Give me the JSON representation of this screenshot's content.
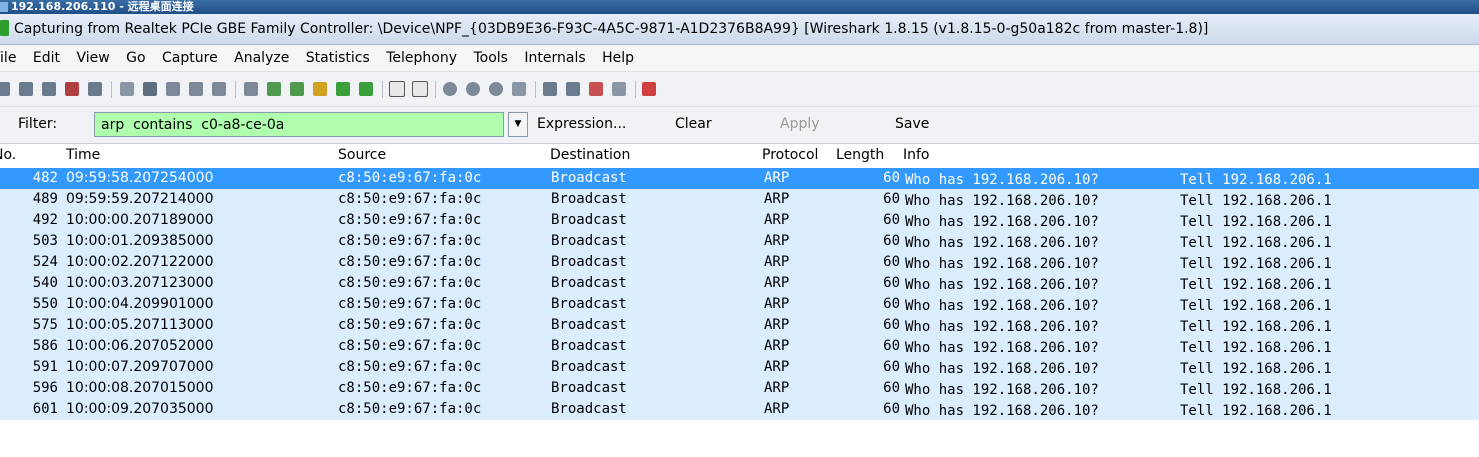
{
  "rdp_title": "192.168.206.110 - 远程桌面连接",
  "window_title": "Capturing from Realtek PCIe GBE Family Controller: \\Device\\NPF_{03DB9E36-F93C-4A5C-9871-A1D2376B8A99}   [Wireshark 1.8.15  (v1.8.15-0-g50a182c from master-1.8)]",
  "menu": [
    "File",
    "Edit",
    "View",
    "Go",
    "Capture",
    "Analyze",
    "Statistics",
    "Telephony",
    "Tools",
    "Internals",
    "Help"
  ],
  "filter": {
    "label": "Filter:",
    "value": "arp  contains  c0-a8-ce-0a",
    "expression_label": "Expression...",
    "clear_label": "Clear",
    "apply_label": "Apply",
    "save_label": "Save",
    "input_color": "#afffaf"
  },
  "columns": [
    "No.",
    "Time",
    "Source",
    "Destination",
    "Protocol",
    "Length",
    "Info"
  ],
  "packets": [
    {
      "no": "482",
      "time": "09:59:58.207254000",
      "source": "c8:50:e9:67:fa:0c",
      "destination": "Broadcast",
      "protocol": "ARP",
      "length": "60",
      "info": "Who has 192.168.206.10?",
      "info_tell": "Tell 192.168.206.1"
    },
    {
      "no": "489",
      "time": "09:59:59.207214000",
      "source": "c8:50:e9:67:fa:0c",
      "destination": "Broadcast",
      "protocol": "ARP",
      "length": "60",
      "info": "Who has 192.168.206.10?",
      "info_tell": "Tell 192.168.206.1"
    },
    {
      "no": "492",
      "time": "10:00:00.207189000",
      "source": "c8:50:e9:67:fa:0c",
      "destination": "Broadcast",
      "protocol": "ARP",
      "length": "60",
      "info": "Who has 192.168.206.10?",
      "info_tell": "Tell 192.168.206.1"
    },
    {
      "no": "503",
      "time": "10:00:01.209385000",
      "source": "c8:50:e9:67:fa:0c",
      "destination": "Broadcast",
      "protocol": "ARP",
      "length": "60",
      "info": "Who has 192.168.206.10?",
      "info_tell": "Tell 192.168.206.1"
    },
    {
      "no": "524",
      "time": "10:00:02.207122000",
      "source": "c8:50:e9:67:fa:0c",
      "destination": "Broadcast",
      "protocol": "ARP",
      "length": "60",
      "info": "Who has 192.168.206.10?",
      "info_tell": "Tell 192.168.206.1"
    },
    {
      "no": "540",
      "time": "10:00:03.207123000",
      "source": "c8:50:e9:67:fa:0c",
      "destination": "Broadcast",
      "protocol": "ARP",
      "length": "60",
      "info": "Who has 192.168.206.10?",
      "info_tell": "Tell 192.168.206.1"
    },
    {
      "no": "550",
      "time": "10:00:04.209901000",
      "source": "c8:50:e9:67:fa:0c",
      "destination": "Broadcast",
      "protocol": "ARP",
      "length": "60",
      "info": "Who has 192.168.206.10?",
      "info_tell": "Tell 192.168.206.1"
    },
    {
      "no": "575",
      "time": "10:00:05.207113000",
      "source": "c8:50:e9:67:fa:0c",
      "destination": "Broadcast",
      "protocol": "ARP",
      "length": "60",
      "info": "Who has 192.168.206.10?",
      "info_tell": "Tell 192.168.206.1"
    },
    {
      "no": "586",
      "time": "10:00:06.207052000",
      "source": "c8:50:e9:67:fa:0c",
      "destination": "Broadcast",
      "protocol": "ARP",
      "length": "60",
      "info": "Who has 192.168.206.10?",
      "info_tell": "Tell 192.168.206.1"
    },
    {
      "no": "591",
      "time": "10:00:07.209707000",
      "source": "c8:50:e9:67:fa:0c",
      "destination": "Broadcast",
      "protocol": "ARP",
      "length": "60",
      "info": "Who has 192.168.206.10?",
      "info_tell": "Tell 192.168.206.1"
    },
    {
      "no": "596",
      "time": "10:00:08.207015000",
      "source": "c8:50:e9:67:fa:0c",
      "destination": "Broadcast",
      "protocol": "ARP",
      "length": "60",
      "info": "Who has 192.168.206.10?",
      "info_tell": "Tell 192.168.206.1"
    },
    {
      "no": "601",
      "time": "10:00:09.207035000",
      "source": "c8:50:e9:67:fa:0c",
      "destination": "Broadcast",
      "protocol": "ARP",
      "length": "60",
      "info": "Who has 192.168.206.10?",
      "info_tell": "Tell 192.168.206.1"
    }
  ],
  "selected_row_color": "#3399ff",
  "row_color": "#daeeff"
}
